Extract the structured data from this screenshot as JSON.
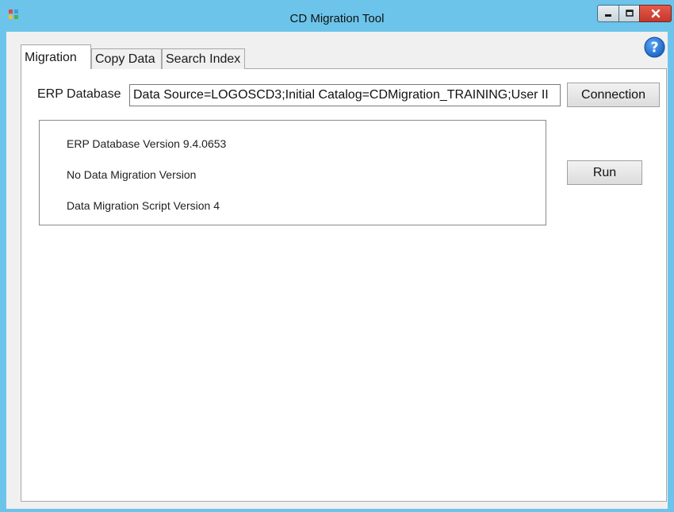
{
  "window": {
    "title": "CD Migration Tool",
    "controls": {
      "minimize_icon": "minimize-icon",
      "maximize_icon": "maximize-icon",
      "close_icon": "close-icon",
      "close_glyph": "x"
    }
  },
  "tabs": [
    {
      "label": "Migration",
      "active": true
    },
    {
      "label": "Copy Data",
      "active": false
    },
    {
      "label": "Search Index",
      "active": false
    }
  ],
  "erp": {
    "label": "ERP Database",
    "connection_string": "Data Source=LOGOSCD3;Initial Catalog=CDMigration_TRAINING;User II"
  },
  "buttons": {
    "connection": "Connection",
    "run": "Run"
  },
  "info": {
    "line1": "ERP Database Version 9.4.0653",
    "line2": "No Data Migration Version",
    "line3": "Data Migration Script Version 4"
  },
  "colors": {
    "titlebar": "#6cc4ea",
    "close_button": "#d2463a",
    "help_icon": "#1f6fd1"
  }
}
